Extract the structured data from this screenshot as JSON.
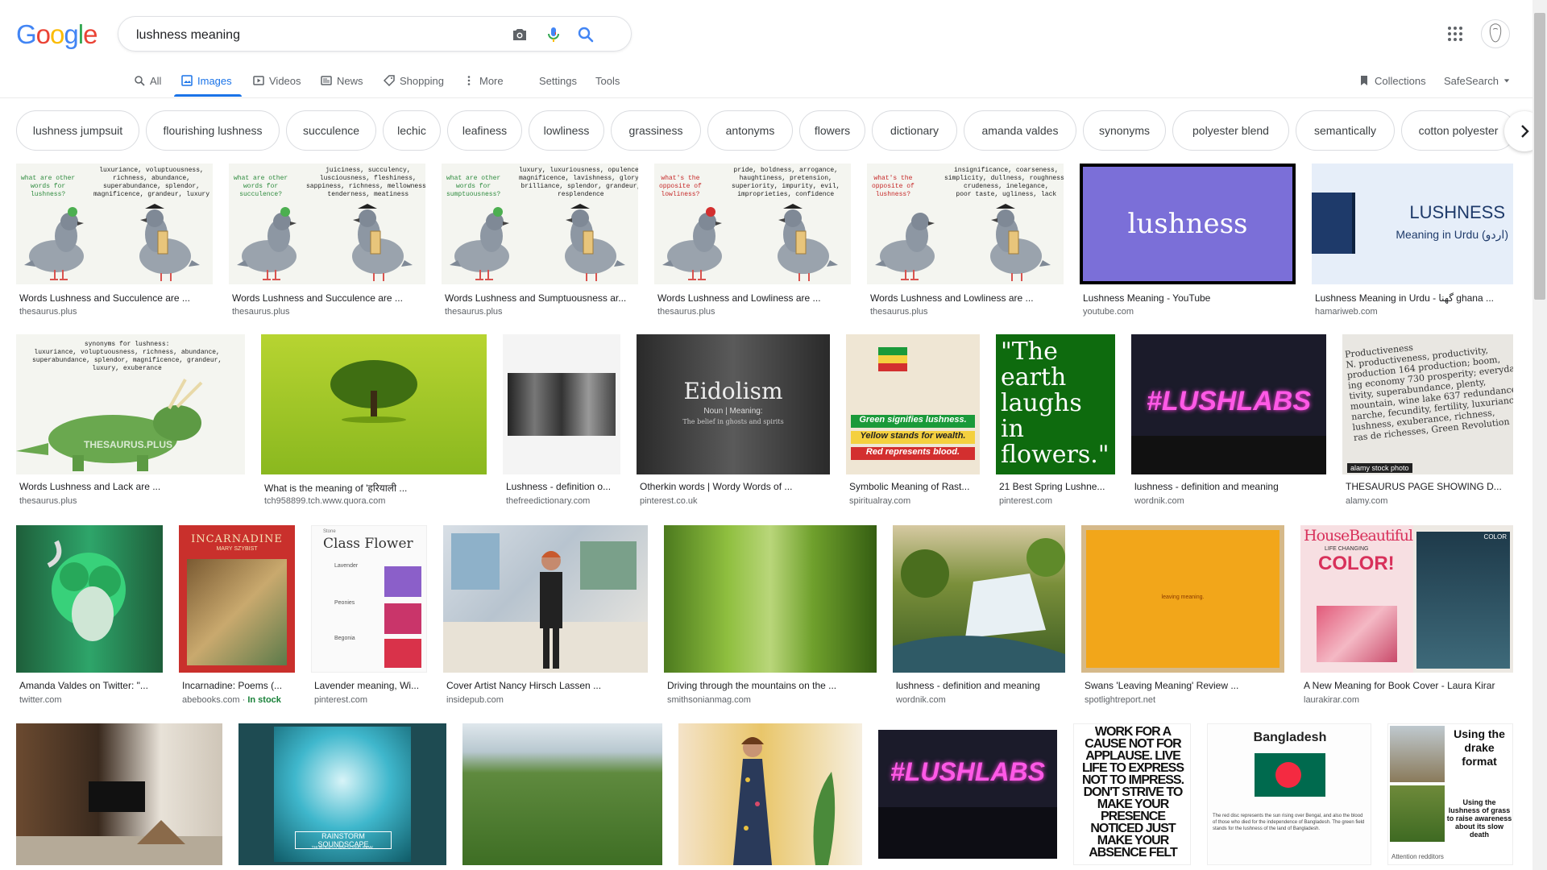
{
  "header": {
    "logo_letters": [
      {
        "ch": "G",
        "color": "#4285f4"
      },
      {
        "ch": "o",
        "color": "#ea4335"
      },
      {
        "ch": "o",
        "color": "#fbbc05"
      },
      {
        "ch": "g",
        "color": "#4285f4"
      },
      {
        "ch": "l",
        "color": "#34a853"
      },
      {
        "ch": "e",
        "color": "#ea4335"
      }
    ],
    "search_value": "lushness meaning",
    "icons": [
      "camera-icon",
      "microphone-icon",
      "search-icon",
      "apps-grid-icon",
      "avatar"
    ]
  },
  "nav": {
    "all": "All",
    "images": "Images",
    "videos": "Videos",
    "news": "News",
    "shopping": "Shopping",
    "more": "More",
    "settings": "Settings",
    "tools": "Tools",
    "collections": "Collections",
    "safesearch": "SafeSearch"
  },
  "chips": [
    "lushness jumpsuit",
    "flourishing lushness",
    "succulence",
    "lechic",
    "leafiness",
    "lowliness",
    "grassiness",
    "antonyms",
    "flowers",
    "dictionary",
    "amanda valdes",
    "synonyms",
    "polyester blend",
    "semantically",
    "cotton polyester"
  ],
  "row1": [
    {
      "title": "Words Lushness and Succulence are ...",
      "source": "thesaurus.plus",
      "q": "what are other\nwords for\nlushness?",
      "words": "luxuriance, voluptuousness,\nrichness, abundance,\nsuperabundance, splendor,\nmagnificence, grandeur, luxury"
    },
    {
      "title": "Words Lushness and Succulence are ...",
      "source": "thesaurus.plus",
      "q": "what are other\nwords for\nsucculence?",
      "words": "juiciness, succulency,\nlusciousness, fleshiness,\nsappiness, richness, mellowness,\ntenderness, meatiness"
    },
    {
      "title": "Words Lushness and Sumptuousness ar...",
      "source": "thesaurus.plus",
      "q": "what are other\nwords for\nsumptuousness?",
      "words": "luxury, luxuriousness, opulence,\nmagnificence, lavishness, glory,\nbrilliance, splendor, grandeur,\nresplendence"
    },
    {
      "title": "Words Lushness and Lowliness are ...",
      "source": "thesaurus.plus",
      "q": "what's the\nopposite of\nlowliness?",
      "words": "pride, boldness, arrogance,\nhaughtiness, pretension,\nsuperiority, impurity, evil,\nimproprieties, confidence"
    },
    {
      "title": "Words Lushness and Lowliness are ...",
      "source": "thesaurus.plus",
      "q": "what's the\nopposite of\nlushness?",
      "words": "insignificance, coarseness,\nsimplicity, dullness, roughness,\ncrudeness, inelegance,\npoor taste, ugliness, lack"
    },
    {
      "title": "Lushness Meaning - YouTube",
      "source": "youtube.com",
      "big": "lushness"
    },
    {
      "title": "Lushness Meaning in Urdu - گھنا ghana ...",
      "source": "hamariweb.com",
      "big": "LUSHNESS",
      "sub": "Meaning in Urdu (اردو)"
    }
  ],
  "row2": [
    {
      "title": "Words Lushness and Lack are ...",
      "source": "thesaurus.plus",
      "words": "synonyms for lushness:\nluxuriance, voluptuousness, richness, abundance,\nsuperabundance, splendor, magnificence, grandeur,\nluxury, exuberance",
      "brand": "THESAURUS.PLUS"
    },
    {
      "title": "What is the meaning of 'हरियाली ...",
      "source": "tch958899.tch.www.quora.com"
    },
    {
      "title": "Lushness - definition o...",
      "source": "thefreedictionary.com"
    },
    {
      "title": "Otherkin words | Wordy Words of ...",
      "source": "pinterest.co.uk",
      "big": "Eidolism",
      "sub": "Noun | Meaning:",
      "sub2": "The belief in ghosts and spirits"
    },
    {
      "title": "Symbolic Meaning of Rast...",
      "source": "spiritualray.com",
      "lines": [
        "Green signifies lushness.",
        "Yellow stands for wealth.",
        "Red represents blood."
      ]
    },
    {
      "title": "21 Best Spring Lushne...",
      "source": "pinterest.com",
      "quote": "\"The earth laughs in flowers.\""
    },
    {
      "title": "lushness - definition and meaning",
      "source": "wordnik.com",
      "neon": "#LUSHLABS"
    },
    {
      "title": "THESAURUS PAGE SHOWING D...",
      "source": "alamy.com",
      "text": "Productiveness\nN. productiveness, productivity,\nproduction 164 production; boom,\ning economy 730 prosperity; everyday\ntivity, superabundance, plenty,\nmountain, wine lake 637 redundance,\nnarche, fecundity, fertility, luxuriance,\nlushness, exuberance, richness,\nras de richesses, Green Revolution",
      "badge": "alamy stock photo"
    }
  ],
  "row3": [
    {
      "title": "Amanda Valdes on Twitter: \"...",
      "source": "twitter.com"
    },
    {
      "title": "Incarnadine: Poems (...",
      "source": "abebooks.com",
      "stock": "In stock",
      "book_title": "INCARNADINE",
      "author": "MARY SZYBIST"
    },
    {
      "title": "Lavender meaning, Wi...",
      "source": "pinterest.com",
      "card_title": "Class Flower",
      "card_small": "Stone",
      "items": [
        "Lavender",
        "Peonies",
        "Begonia"
      ]
    },
    {
      "title": "Cover Artist Nancy Hirsch Lassen ...",
      "source": "insidepub.com"
    },
    {
      "title": "Driving through the mountains on the ...",
      "source": "smithsonianmag.com"
    },
    {
      "title": "lushness - definition and meaning",
      "source": "wordnik.com"
    },
    {
      "title": "Swans 'Leaving Meaning' Review ...",
      "source": "spotlightreport.net",
      "cover": "leaving meaning."
    },
    {
      "title": "A New Meaning for Book Cover - Laura Kirar",
      "source": "laurakirar.com",
      "mag": "HouseBeautiful",
      "mag2": "LIFE CHANGING",
      "mag3": "COLOR!",
      "mag4": "COLOR"
    }
  ],
  "row4": [
    {
      "kind": "room"
    },
    {
      "kind": "album",
      "label": "RAINSTORM SOUNDSCAPE",
      "sub": "THUNDERSTORM SOUND BANK"
    },
    {
      "kind": "valley"
    },
    {
      "kind": "dress"
    },
    {
      "kind": "neon",
      "neon": "#LUSHLABS"
    },
    {
      "kind": "poster",
      "text": "WORK FOR A CAUSE NOT FOR APPLAUSE. LIVE LIFE TO EXPRESS NOT TO IMPRESS. DON'T STRIVE TO MAKE YOUR PRESENCE NOTICED JUST MAKE YOUR ABSENCE FELT"
    },
    {
      "kind": "flag",
      "heading": "Bangladesh",
      "body": "The red disc represents the sun rising over Bengal, and also the blood of those who died for the independence of Bangladesh. The green field stands for the lushness of the land of Bangladesh."
    },
    {
      "kind": "drake",
      "heading": "Using the drake format",
      "body": "Using the lushness of grass to raise awareness about its slow death",
      "foot": "Attention redditors"
    }
  ],
  "colors": {
    "accent": "#1a73e8",
    "chip_border": "#dadce0",
    "caption": "#202124",
    "source": "#5f6368"
  }
}
